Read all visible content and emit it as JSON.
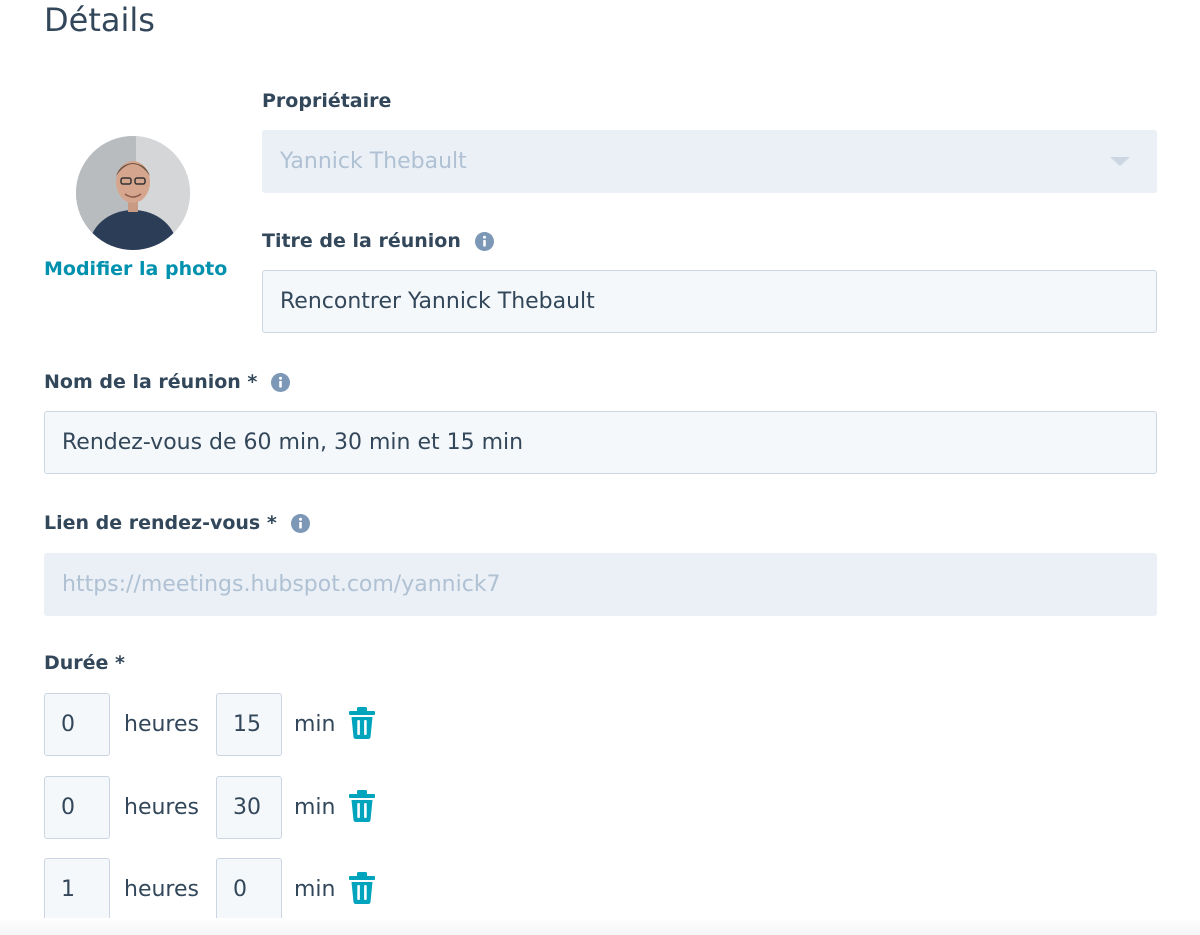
{
  "page": {
    "title": "Détails"
  },
  "avatar": {
    "edit_link": "Modifier la photo"
  },
  "owner": {
    "label": "Propriétaire",
    "value": "Yannick Thebault"
  },
  "meeting_title": {
    "label": "Titre de la réunion",
    "value": "Rencontrer Yannick Thebault",
    "info_icon": "info-icon"
  },
  "meeting_name": {
    "label": "Nom de la réunion *",
    "value": "Rendez-vous de 60 min, 30 min et 15 min",
    "info_icon": "info-icon"
  },
  "meeting_link": {
    "label": "Lien de rendez-vous *",
    "placeholder": "https://meetings.hubspot.com/yannick7",
    "info_icon": "info-icon"
  },
  "duration": {
    "label": "Durée *",
    "hours_unit": "heures",
    "minutes_unit": "min",
    "delete_icon": "trash-icon",
    "rows": [
      {
        "hours": "0",
        "minutes": "15"
      },
      {
        "hours": "0",
        "minutes": "30"
      },
      {
        "hours": "1",
        "minutes": "0"
      }
    ]
  },
  "colors": {
    "text": "#33475b",
    "link": "#0091ae",
    "input_bg": "#f5f8fa",
    "input_border": "#cbd6e2",
    "disabled_bg": "#eaf0f6",
    "disabled_text": "#b0c1d4",
    "info_icon": "#7c98b6"
  }
}
